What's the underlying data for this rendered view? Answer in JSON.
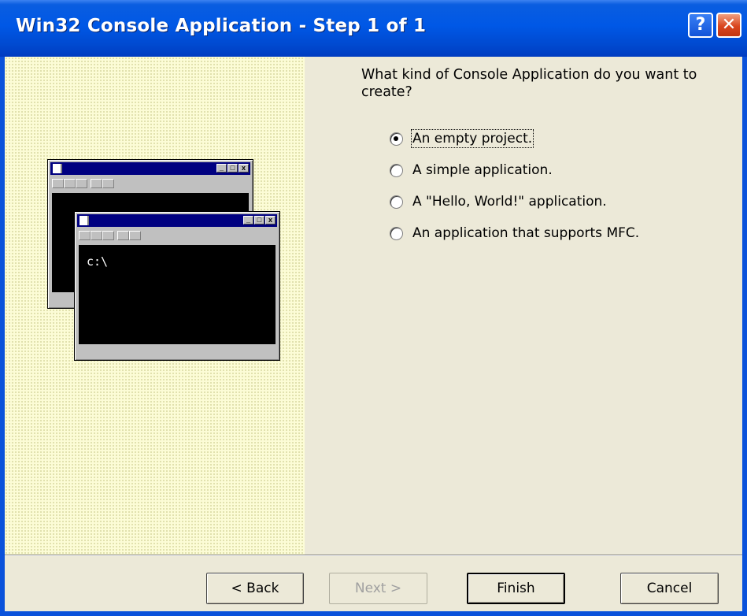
{
  "window": {
    "title": "Win32 Console Application - Step 1 of 1",
    "help_glyph": "?",
    "close_glyph": "✕",
    "title_color": "#0058e6"
  },
  "illustration": {
    "prompt_text": "c:\\"
  },
  "question": "What kind of Console Application do you want to create?",
  "options": [
    {
      "label": "An empty project.",
      "selected": true
    },
    {
      "label": "A simple application.",
      "selected": false
    },
    {
      "label": "A \"Hello, World!\" application.",
      "selected": false
    },
    {
      "label": "An application that supports MFC.",
      "selected": false
    }
  ],
  "buttons": {
    "back": "< Back",
    "next": "Next >",
    "finish": "Finish",
    "cancel": "Cancel"
  }
}
